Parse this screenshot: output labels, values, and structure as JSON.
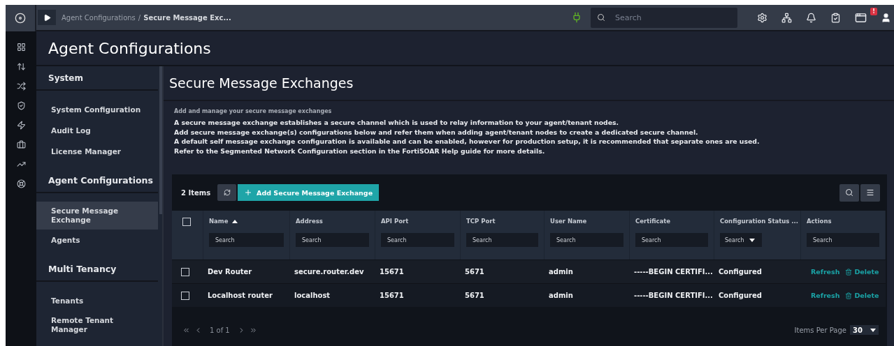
{
  "topbar": {
    "breadcrumb_separator": "/",
    "breadcrumb": [
      {
        "label": "Agent Configurations",
        "current": false
      },
      {
        "label": "Secure Message Exc...",
        "current": true
      }
    ],
    "search": {
      "placeholder": "Search"
    },
    "notification_badge": "!"
  },
  "page_title": "Agent Configurations",
  "sidebar": {
    "sections": [
      {
        "title": "System",
        "items": [
          {
            "label": "System Configuration",
            "selected": false
          },
          {
            "label": "Audit Log",
            "selected": false
          },
          {
            "label": "License Manager",
            "selected": false
          }
        ]
      },
      {
        "title": "Agent Configurations",
        "items": [
          {
            "label": "Secure Message Exchange",
            "selected": true
          },
          {
            "label": "Agents",
            "selected": false
          }
        ]
      },
      {
        "title": "Multi Tenancy",
        "items": [
          {
            "label": "Tenants",
            "selected": false
          },
          {
            "label": "Remote Tenant Manager",
            "selected": false
          }
        ]
      }
    ]
  },
  "content": {
    "title": "Secure Message Exchanges",
    "subtitle": "Add and manage your secure message exchanges",
    "description": [
      "A secure message exchange establishes a secure channel which is used to relay information to your agent/tenant nodes.",
      "Add secure message exchange(s) configurations below and refer them when adding agent/tenant nodes to create a dedicated secure channel.",
      "A default self message exchange configuration is available and can be enabled, however for production setup, it is recommended that separate ones are used.",
      "Refer to the Segmented Network Configuration section in the FortiSOAR Help guide for more details."
    ]
  },
  "table": {
    "count": "2 Items",
    "all_checked": false,
    "add_button": "Add Secure Message Exchange",
    "columns": [
      {
        "label": "Name",
        "sorted": true,
        "kind": "text",
        "placeholder": "Search"
      },
      {
        "label": "Address",
        "sorted": false,
        "kind": "text",
        "placeholder": "Search"
      },
      {
        "label": "API Port",
        "sorted": false,
        "kind": "text",
        "placeholder": "Search"
      },
      {
        "label": "TCP Port",
        "sorted": false,
        "kind": "text",
        "placeholder": "Search"
      },
      {
        "label": "User Name",
        "sorted": false,
        "kind": "text",
        "placeholder": "Search"
      },
      {
        "label": "Certificate",
        "sorted": false,
        "kind": "text",
        "placeholder": "Search"
      },
      {
        "label": "Configuration Status ...",
        "sorted": false,
        "kind": "select",
        "placeholder": "Search"
      },
      {
        "label": "Actions",
        "sorted": false,
        "kind": "text",
        "placeholder": "Search"
      }
    ],
    "rows": [
      {
        "checked": false,
        "cells": [
          "Dev Router",
          "secure.router.dev",
          "15671",
          "5671",
          "admin",
          "-----BEGIN CERTIFI...",
          "Configured"
        ],
        "actions": [
          "Refresh",
          "Delete"
        ]
      },
      {
        "checked": false,
        "cells": [
          "Localhost router",
          "localhost",
          "15671",
          "5671",
          "admin",
          "-----BEGIN CERTIFI...",
          "Configured"
        ],
        "actions": [
          "Refresh",
          "Delete"
        ]
      }
    ],
    "pagination": {
      "page": "1 of 1",
      "per_page_label": "Items Per Page",
      "per_page": "30"
    }
  }
}
